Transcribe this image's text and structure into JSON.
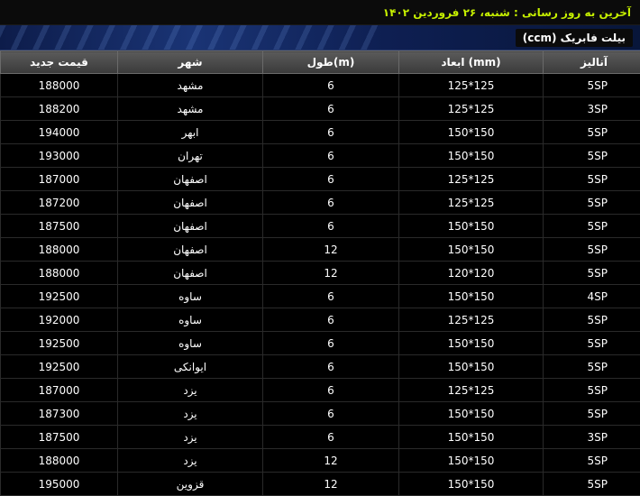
{
  "last_update": "آخرین به روز رسانی : شنبه، ۲۶ فروردین ۱۴۰۲",
  "section_title": "بیلت فابریک (ccm)",
  "columns": {
    "price": "قیمت جدید",
    "city": "شهر",
    "length": "طول(m)",
    "dimensions": "ابعاد (mm)",
    "analysis": "آنالیز"
  },
  "rows": [
    {
      "price": "188000",
      "city": "مشهد",
      "length": "6",
      "dimensions": "125*125",
      "analysis": "5SP"
    },
    {
      "price": "188200",
      "city": "مشهد",
      "length": "6",
      "dimensions": "125*125",
      "analysis": "3SP"
    },
    {
      "price": "194000",
      "city": "ابهر",
      "length": "6",
      "dimensions": "150*150",
      "analysis": "5SP"
    },
    {
      "price": "193000",
      "city": "تهران",
      "length": "6",
      "dimensions": "150*150",
      "analysis": "5SP"
    },
    {
      "price": "187000",
      "city": "اصفهان",
      "length": "6",
      "dimensions": "125*125",
      "analysis": "5SP"
    },
    {
      "price": "187200",
      "city": "اصفهان",
      "length": "6",
      "dimensions": "125*125",
      "analysis": "5SP"
    },
    {
      "price": "187500",
      "city": "اصفهان",
      "length": "6",
      "dimensions": "150*150",
      "analysis": "5SP"
    },
    {
      "price": "188000",
      "city": "اصفهان",
      "length": "12",
      "dimensions": "150*150",
      "analysis": "5SP"
    },
    {
      "price": "188000",
      "city": "اصفهان",
      "length": "12",
      "dimensions": "120*120",
      "analysis": "5SP"
    },
    {
      "price": "192500",
      "city": "ساوه",
      "length": "6",
      "dimensions": "150*150",
      "analysis": "4SP"
    },
    {
      "price": "192000",
      "city": "ساوه",
      "length": "6",
      "dimensions": "125*125",
      "analysis": "5SP"
    },
    {
      "price": "192500",
      "city": "ساوه",
      "length": "6",
      "dimensions": "150*150",
      "analysis": "5SP"
    },
    {
      "price": "192500",
      "city": "ایوانکی",
      "length": "6",
      "dimensions": "150*150",
      "analysis": "5SP"
    },
    {
      "price": "187000",
      "city": "یزد",
      "length": "6",
      "dimensions": "125*125",
      "analysis": "5SP"
    },
    {
      "price": "187300",
      "city": "یزد",
      "length": "6",
      "dimensions": "150*150",
      "analysis": "5SP"
    },
    {
      "price": "187500",
      "city": "یزد",
      "length": "6",
      "dimensions": "150*150",
      "analysis": "3SP"
    },
    {
      "price": "188000",
      "city": "یزد",
      "length": "12",
      "dimensions": "150*150",
      "analysis": "5SP"
    },
    {
      "price": "195000",
      "city": "قزوین",
      "length": "12",
      "dimensions": "150*150",
      "analysis": "5SP"
    }
  ]
}
